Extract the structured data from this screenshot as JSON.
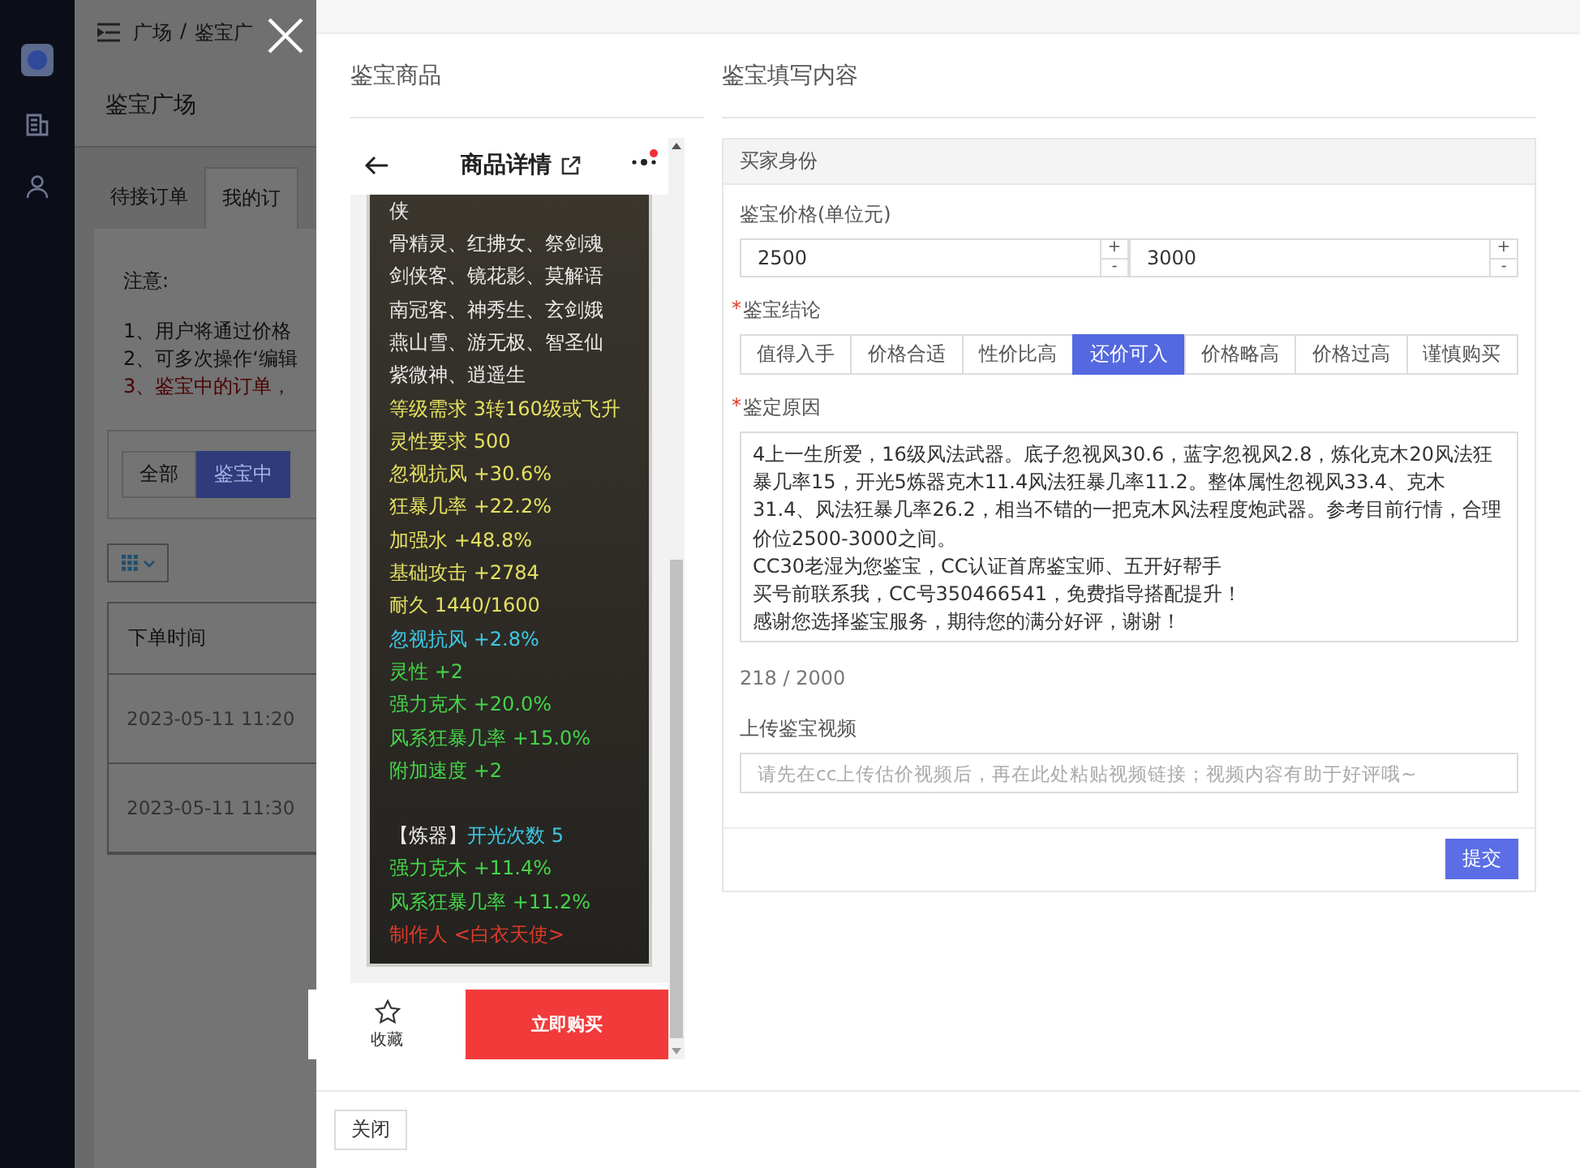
{
  "background_page": {
    "breadcrumb": [
      "广场",
      "鉴宝广"
    ],
    "breadcrumb_separator": "/",
    "title": "鉴宝广场",
    "tabs": [
      {
        "label": "待接订单",
        "selected": false
      },
      {
        "label": "我的订",
        "selected": true
      }
    ],
    "notice_title": "注意:",
    "notices": [
      {
        "text": "1、用户将通过价格",
        "kind": "normal"
      },
      {
        "text": "2、可多次操作‘编辑",
        "kind": "normal"
      },
      {
        "text": "3、鉴宝中的订单，",
        "kind": "warning"
      }
    ],
    "filters": [
      {
        "label": "全部",
        "selected": false
      },
      {
        "label": "鉴宝中",
        "selected": true
      }
    ],
    "table": {
      "columns": [
        "下单时间"
      ],
      "rows": [
        [
          "2023-05-11 11:20"
        ],
        [
          "2023-05-11 11:30"
        ]
      ]
    }
  },
  "drawer": {
    "product_section_title": "鉴宝商品",
    "form_section_title": "鉴宝填写内容",
    "close_button": "关闭"
  },
  "product": {
    "title": "商品详情",
    "blocks": [
      {
        "lines": [
          {
            "segments": [
              {
                "text": "侠",
                "color": "#e8e8e8"
              }
            ]
          },
          {
            "segments": [
              {
                "text": "骨精灵、红拂女、祭剑魂",
                "color": "#e8e8e8"
              }
            ]
          },
          {
            "segments": [
              {
                "text": "剑侠客、镜花影、莫解语",
                "color": "#e8e8e8"
              }
            ]
          },
          {
            "segments": [
              {
                "text": "南冠客、神秀生、玄剑娥",
                "color": "#e8e8e8"
              }
            ]
          },
          {
            "segments": [
              {
                "text": "燕山雪、游无极、智圣仙",
                "color": "#e8e8e8"
              }
            ]
          },
          {
            "segments": [
              {
                "text": "紫微神、逍遥生",
                "color": "#e8e8e8"
              }
            ]
          },
          {
            "segments": [
              {
                "text": "等级需求 3转160级或飞升",
                "color": "#e4e060"
              }
            ]
          },
          {
            "segments": [
              {
                "text": "灵性要求 500",
                "color": "#e4e060"
              }
            ]
          },
          {
            "segments": [
              {
                "text": "忽视抗风 +30.6%",
                "color": "#e4e060"
              }
            ]
          },
          {
            "segments": [
              {
                "text": "狂暴几率 +22.2%",
                "color": "#e4e060"
              }
            ]
          },
          {
            "segments": [
              {
                "text": "加强水 +48.8%",
                "color": "#e4e060"
              }
            ]
          },
          {
            "segments": [
              {
                "text": "基础攻击 +2784",
                "color": "#e4e060"
              }
            ]
          },
          {
            "segments": [
              {
                "text": "耐久 1440/1600",
                "color": "#e4e060"
              }
            ]
          },
          {
            "segments": [
              {
                "text": "忽视抗风 +2.8%",
                "color": "#3ec8e4"
              }
            ]
          },
          {
            "segments": [
              {
                "text": "灵性 +2",
                "color": "#44d448"
              }
            ]
          },
          {
            "segments": [
              {
                "text": "强力克木 +20.0%",
                "color": "#44d448"
              }
            ]
          },
          {
            "segments": [
              {
                "text": "风系狂暴几率 +15.0%",
                "color": "#44d448"
              }
            ]
          },
          {
            "segments": [
              {
                "text": "附加速度 +2",
                "color": "#44d448"
              }
            ]
          }
        ]
      },
      {
        "lines": [
          {
            "segments": [
              {
                "text": "【炼器】",
                "color": "#e8e8e8"
              },
              {
                "text": "开光次数 5",
                "color": "#3ec8e4"
              }
            ]
          },
          {
            "segments": [
              {
                "text": "强力克木 +11.4%",
                "color": "#44d448"
              }
            ]
          },
          {
            "segments": [
              {
                "text": "风系狂暴几率 +11.2%",
                "color": "#44d448"
              }
            ]
          },
          {
            "segments": [
              {
                "text": "制作人 <白衣天使>",
                "color": "#e03a2a"
              }
            ]
          }
        ]
      }
    ],
    "favorite_label": "收藏",
    "buy_label": "立即购买"
  },
  "form": {
    "card_title": "买家身份",
    "price_label": "鉴宝价格(单位元)",
    "prices": [
      {
        "value": "2500",
        "increment": "+",
        "decrement": "-"
      },
      {
        "value": "3000",
        "increment": "+",
        "decrement": "-"
      }
    ],
    "conclusion": {
      "required_mark": "*",
      "label": "鉴宝结论",
      "options": [
        {
          "label": "值得入手",
          "selected": false
        },
        {
          "label": "价格合适",
          "selected": false
        },
        {
          "label": "性价比高",
          "selected": false
        },
        {
          "label": "还价可入",
          "selected": true
        },
        {
          "label": "价格略高",
          "selected": false
        },
        {
          "label": "价格过高",
          "selected": false
        },
        {
          "label": "谨慎购买",
          "selected": false
        }
      ]
    },
    "reason": {
      "required_mark": "*",
      "label": "鉴定原因",
      "paragraphs": [
        "4上一生所爱，16级风法武器。底子忽视风30.6，蓝字忽视风2.8，炼化克木20风法狂暴几率15，开光5炼器克木11.4风法狂暴几率11.2。整体属性忽视风33.4、克木31.4、风法狂暴几率26.2，相当不错的一把克木风法程度炮武器。参考目前行情，合理价位2500-3000之间。",
        "CC30老湿为您鉴宝，CC认证首席鉴宝师、五开好帮手",
        "买号前联系我，CC号350466541，免费指导搭配提升！",
        "感谢您选择鉴宝服务，期待您的满分好评，谢谢！"
      ],
      "count": "218 / 2000"
    },
    "video": {
      "label": "上传鉴宝视频",
      "placeholder": "请先在cc上传估价视频后，再在此处粘贴视频链接；视频内容有助于好评哦~"
    },
    "submit": "提交"
  }
}
